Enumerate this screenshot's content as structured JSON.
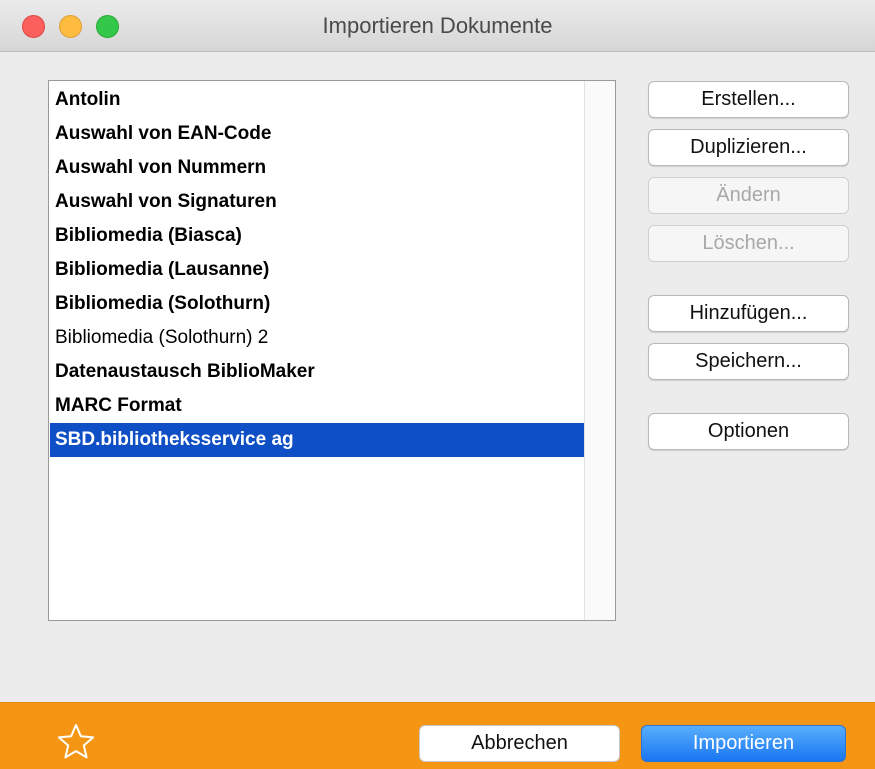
{
  "window": {
    "title": "Importieren Dokumente"
  },
  "list": {
    "items": [
      {
        "label": "Antolin",
        "bold": true
      },
      {
        "label": "Auswahl von EAN-Code",
        "bold": true
      },
      {
        "label": "Auswahl von Nummern",
        "bold": true
      },
      {
        "label": "Auswahl von Signaturen",
        "bold": true
      },
      {
        "label": "Bibliomedia (Biasca)",
        "bold": true
      },
      {
        "label": "Bibliomedia (Lausanne)",
        "bold": true
      },
      {
        "label": "Bibliomedia (Solothurn)",
        "bold": true
      },
      {
        "label": "Bibliomedia (Solothurn) 2",
        "bold": false
      },
      {
        "label": "Datenaustausch BiblioMaker",
        "bold": true
      },
      {
        "label": "MARC Format",
        "bold": true
      },
      {
        "label": "SBD.bibliotheksservice ag",
        "bold": true,
        "selected": true
      }
    ]
  },
  "buttons": {
    "create": "Erstellen...",
    "duplicate": "Duplizieren...",
    "edit": "Ändern",
    "delete": "Löschen...",
    "add": "Hinzufügen...",
    "save": "Speichern...",
    "options": "Optionen"
  },
  "footer": {
    "cancel": "Abbrechen",
    "import": "Importieren",
    "star_icon": "star-outline-icon"
  },
  "colors": {
    "footer_bg": "#f59514",
    "selection": "#0f4fc5",
    "primary_button": "#1976f2"
  }
}
